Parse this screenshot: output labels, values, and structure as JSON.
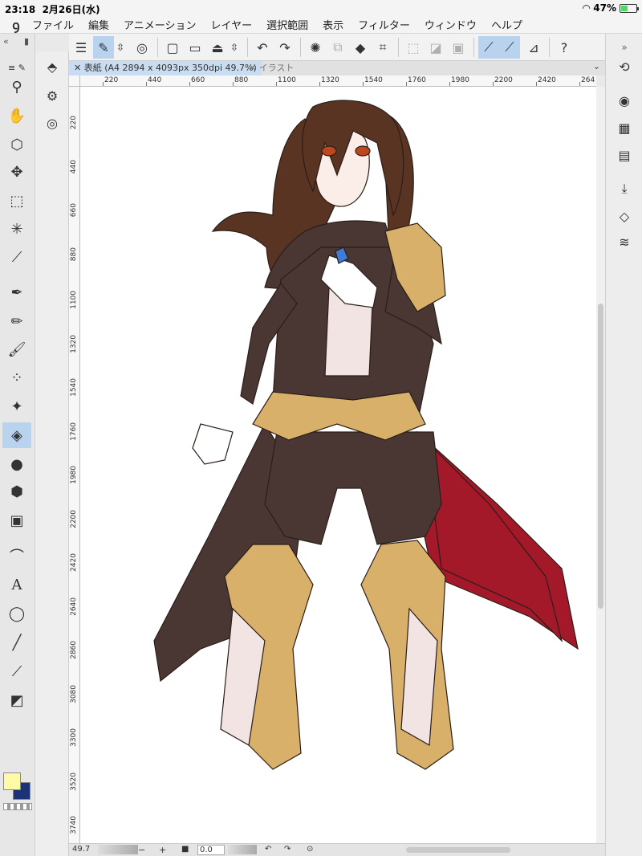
{
  "status": {
    "time": "23:18",
    "date": "2月26日(水)",
    "battery": "47%",
    "battery_level": 0.47
  },
  "menu": {
    "items": [
      "ファイル",
      "編集",
      "アニメーション",
      "レイヤー",
      "選択範囲",
      "表示",
      "フィルター",
      "ウィンドウ",
      "ヘルプ"
    ]
  },
  "tabs": [
    {
      "label": "表紙 (A4 2894 x 4093px 350dpi 49.7%)",
      "active": true
    },
    {
      "label": "イラスト",
      "active": false
    }
  ],
  "ruler": {
    "h_labels": [
      "220",
      "440",
      "660",
      "880",
      "1100",
      "1320",
      "1540",
      "1760",
      "1980",
      "2200",
      "2420",
      "264"
    ],
    "v_labels": [
      "220",
      "440",
      "660",
      "880",
      "1100",
      "1320",
      "1540",
      "1760",
      "1980",
      "2200",
      "2420",
      "2640",
      "2860",
      "3080",
      "3300",
      "3520",
      "3740"
    ]
  },
  "bottom": {
    "zoom": "49.7",
    "zoom_out": "−",
    "zoom_in": "+",
    "rotation": "0.0"
  },
  "tools": [
    "magnifier-icon",
    "hand-icon",
    "object-select-icon",
    "move-icon",
    "marquee-icon",
    "auto-select-icon",
    "eyedropper-icon",
    "pen-icon",
    "pencil-icon",
    "brush-icon",
    "airbrush-icon",
    "decoration-icon",
    "eraser-icon",
    "blend-icon",
    "fill-icon",
    "gradient-icon",
    "figure-icon",
    "text-icon",
    "balloon-icon",
    "ruler-line-icon",
    "correct-line-icon",
    "color-mixer-icon"
  ],
  "colors": {
    "main": "#fdfba5",
    "sub": "#1b3478",
    "active_tool_bg": "#b9d3ee"
  },
  "artwork": {
    "hair": "#5a3423",
    "coat": "#4a3733",
    "coat_lining": "#a3192a",
    "gold": "#d9b06a",
    "vest": "#f1e4e2"
  }
}
